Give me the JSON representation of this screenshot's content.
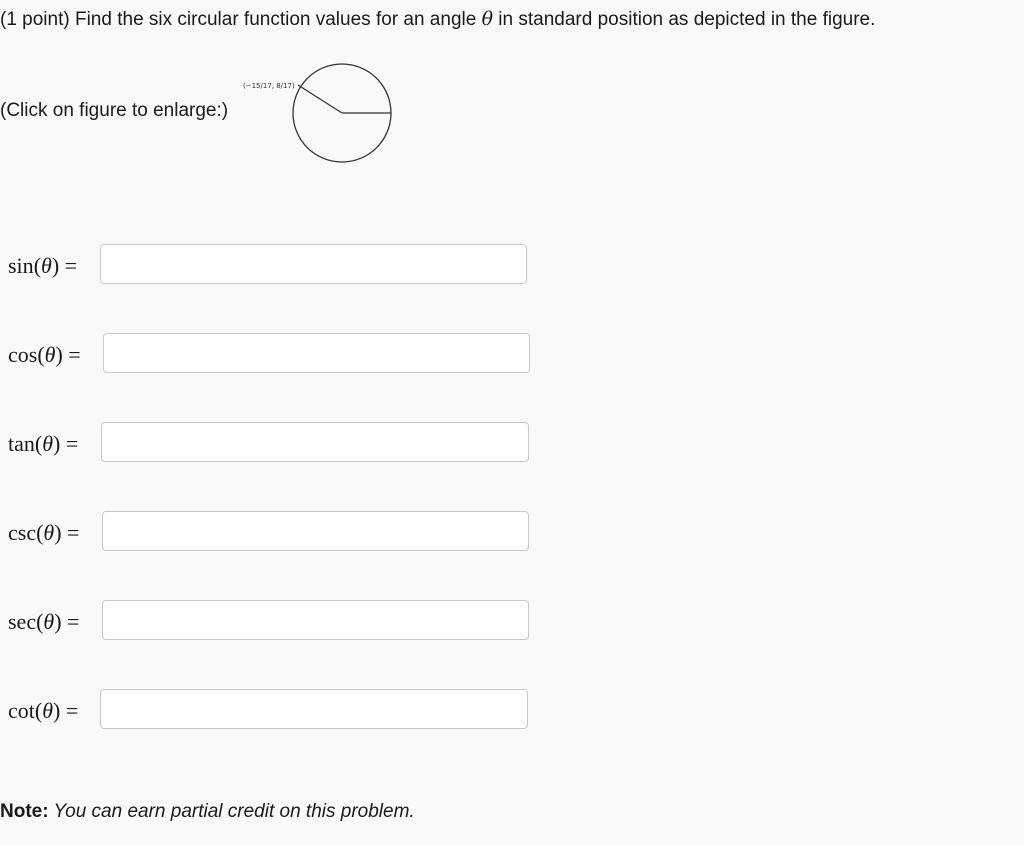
{
  "problem": {
    "prefix": "(1 point) Find the six circular function values for an angle ",
    "theta": "θ",
    "suffix": " in standard position as depicted in the figure.",
    "enlarge_hint": "(Click on figure to enlarge:)"
  },
  "figure": {
    "point_label": "(−15/17, 8/17)"
  },
  "functions": [
    {
      "fn": "sin",
      "open": "(",
      "arg": "θ",
      "close": ") =",
      "value": ""
    },
    {
      "fn": "cos",
      "open": "(",
      "arg": "θ",
      "close": ") =",
      "value": ""
    },
    {
      "fn": "tan",
      "open": "(",
      "arg": "θ",
      "close": ") =",
      "value": ""
    },
    {
      "fn": "csc",
      "open": "(",
      "arg": "θ",
      "close": ") =",
      "value": ""
    },
    {
      "fn": "sec",
      "open": "(",
      "arg": "θ",
      "close": ") =",
      "value": ""
    },
    {
      "fn": "cot",
      "open": "(",
      "arg": "θ",
      "close": ") =",
      "value": ""
    }
  ],
  "note": {
    "bold": "Note:",
    "text": " You can earn partial credit on this problem."
  }
}
